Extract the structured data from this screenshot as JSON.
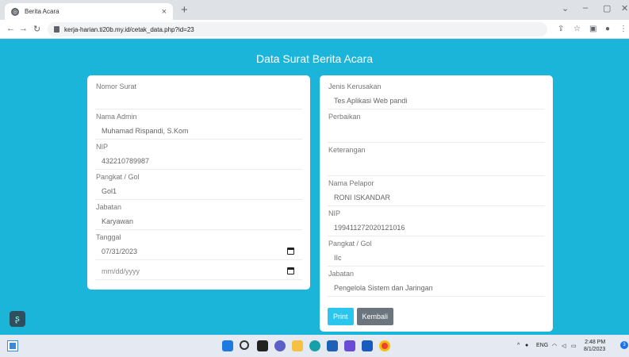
{
  "browser": {
    "tab_title": "Berita Acara",
    "tab_close": "×",
    "new_tab": "+",
    "url": "kerja-harian.ti20b.my.id/cetak_data.php?id=23",
    "controls": {
      "chevron": "⌄",
      "minimize": "–",
      "maximize": "▢",
      "close": "✕"
    }
  },
  "page": {
    "title": "Data Surat Berita Acara",
    "left_fields": [
      {
        "label": "Nomor Surat",
        "value": ""
      },
      {
        "label": "Nama Admin",
        "value": "Muhamad Rispandi, S.Kom"
      },
      {
        "label": "NIP",
        "value": "432210789987"
      },
      {
        "label": "Pangkat / Gol",
        "value": "Gol1"
      },
      {
        "label": "Jabatan",
        "value": "Karyawan"
      }
    ],
    "tanggal": {
      "label": "Tanggal",
      "value": "07/31/2023",
      "placeholder": "mm/dd/yyyy"
    },
    "right_fields": [
      {
        "label": "Jenis Kerusakan",
        "value": "Tes Aplikasi Web pandi"
      },
      {
        "label": "Perbaikan",
        "value": ""
      },
      {
        "label": "Keterangan",
        "value": ""
      },
      {
        "label": "Nama Pelapor",
        "value": "RONI ISKANDAR"
      },
      {
        "label": "NIP",
        "value": "199411272020121016"
      },
      {
        "label": "Pangkat / Gol",
        "value": "IIc"
      },
      {
        "label": "Jabatan",
        "value": "Pengelola Sistem dan Jaringan"
      }
    ],
    "buttons": {
      "print": "Print",
      "back": "Kembali"
    }
  },
  "taskbar": {
    "lang": "ENG",
    "time": "2:48 PM",
    "date": "8/1/2023",
    "notifications": "3"
  }
}
